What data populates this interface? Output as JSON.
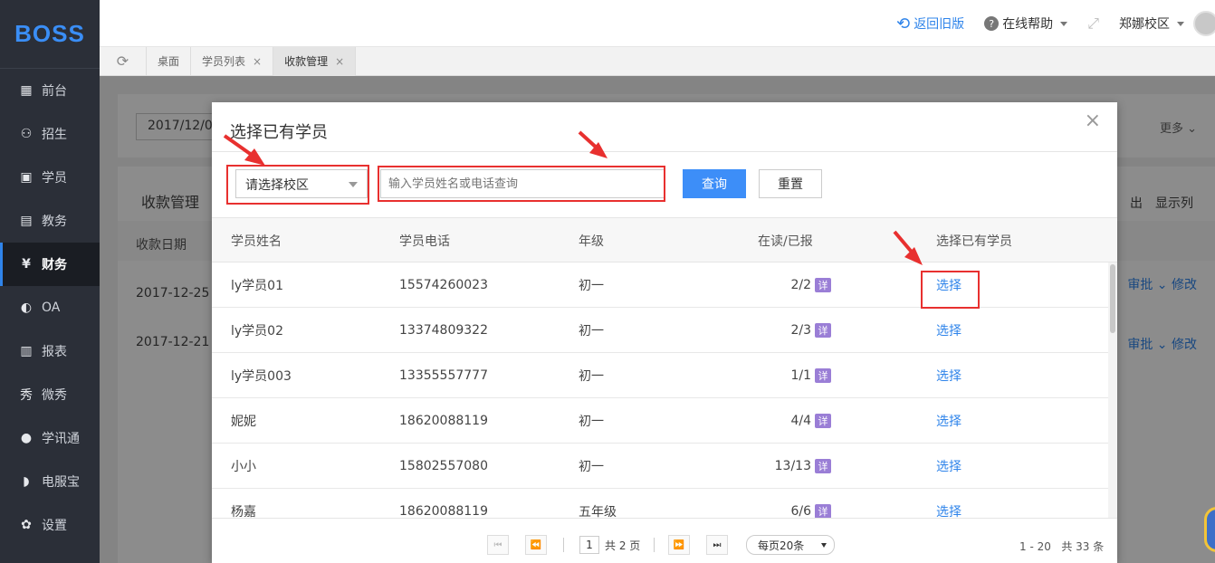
{
  "app": {
    "logo": "BOSS"
  },
  "sidebar": {
    "items": [
      {
        "label": "前台",
        "icon": "calendar-icon"
      },
      {
        "label": "招生",
        "icon": "user-plus-icon"
      },
      {
        "label": "学员",
        "icon": "id-card-icon"
      },
      {
        "label": "教务",
        "icon": "book-icon"
      },
      {
        "label": "财务",
        "icon": "yen-icon",
        "active": true
      },
      {
        "label": "OA",
        "icon": "chat-icon"
      },
      {
        "label": "报表",
        "icon": "bar-chart-icon"
      },
      {
        "label": "微秀",
        "icon": "show-icon"
      },
      {
        "label": "学讯通",
        "icon": "location-pin-icon"
      },
      {
        "label": "电服宝",
        "icon": "phone-icon"
      },
      {
        "label": "设置",
        "icon": "gear-icon"
      }
    ]
  },
  "topbar": {
    "back_label": "返回旧版",
    "help_label": "在线帮助",
    "campus_label": "郑娜校区"
  },
  "tabs": [
    {
      "label": "桌面",
      "closable": false
    },
    {
      "label": "学员列表",
      "closable": true
    },
    {
      "label": "收款管理",
      "closable": true,
      "active": true
    }
  ],
  "background": {
    "date_value": "2017/12/0",
    "more_label": "更多",
    "section_title": "收款管理",
    "export_label": "出",
    "columns_label": "显示列",
    "date_header": "收款日期",
    "rows": [
      {
        "date": "2017-12-25",
        "approve": "审批",
        "edit": "修改"
      },
      {
        "date": "2017-12-21",
        "approve": "审批",
        "edit": "修改"
      }
    ]
  },
  "modal": {
    "title": "选择已有学员",
    "close": "×",
    "campus_select": "请选择校区",
    "search_placeholder": "输入学员姓名或电话查询",
    "query_button": "查询",
    "reset_button": "重置",
    "headers": {
      "name": "学员姓名",
      "phone": "学员电话",
      "grade": "年级",
      "count": "在读/已报",
      "action": "选择已有学员"
    },
    "detail_badge": "详",
    "action_label": "选择",
    "rows": [
      {
        "name": "ly学员01",
        "phone": "15574260023",
        "grade": "初一",
        "count": "2/2"
      },
      {
        "name": "ly学员02",
        "phone": "13374809322",
        "grade": "初一",
        "count": "2/3"
      },
      {
        "name": "ly学员003",
        "phone": "13355557777",
        "grade": "初一",
        "count": "1/1"
      },
      {
        "name": "妮妮",
        "phone": "18620088119",
        "grade": "初一",
        "count": "4/4"
      },
      {
        "name": "小小",
        "phone": "15802557080",
        "grade": "初一",
        "count": "13/13"
      },
      {
        "name": "杨嘉",
        "phone": "18620088119",
        "grade": "五年级",
        "count": "6/6"
      }
    ],
    "pagination": {
      "current_page": "1",
      "total_pages": "共 2 页",
      "page_size": "每页20条",
      "range": "1 - 20",
      "total": "共 33 条"
    }
  },
  "colors": {
    "accent": "#2f84ea",
    "highlight": "#e8302f",
    "sidebar_bg": "#2b2f38"
  }
}
